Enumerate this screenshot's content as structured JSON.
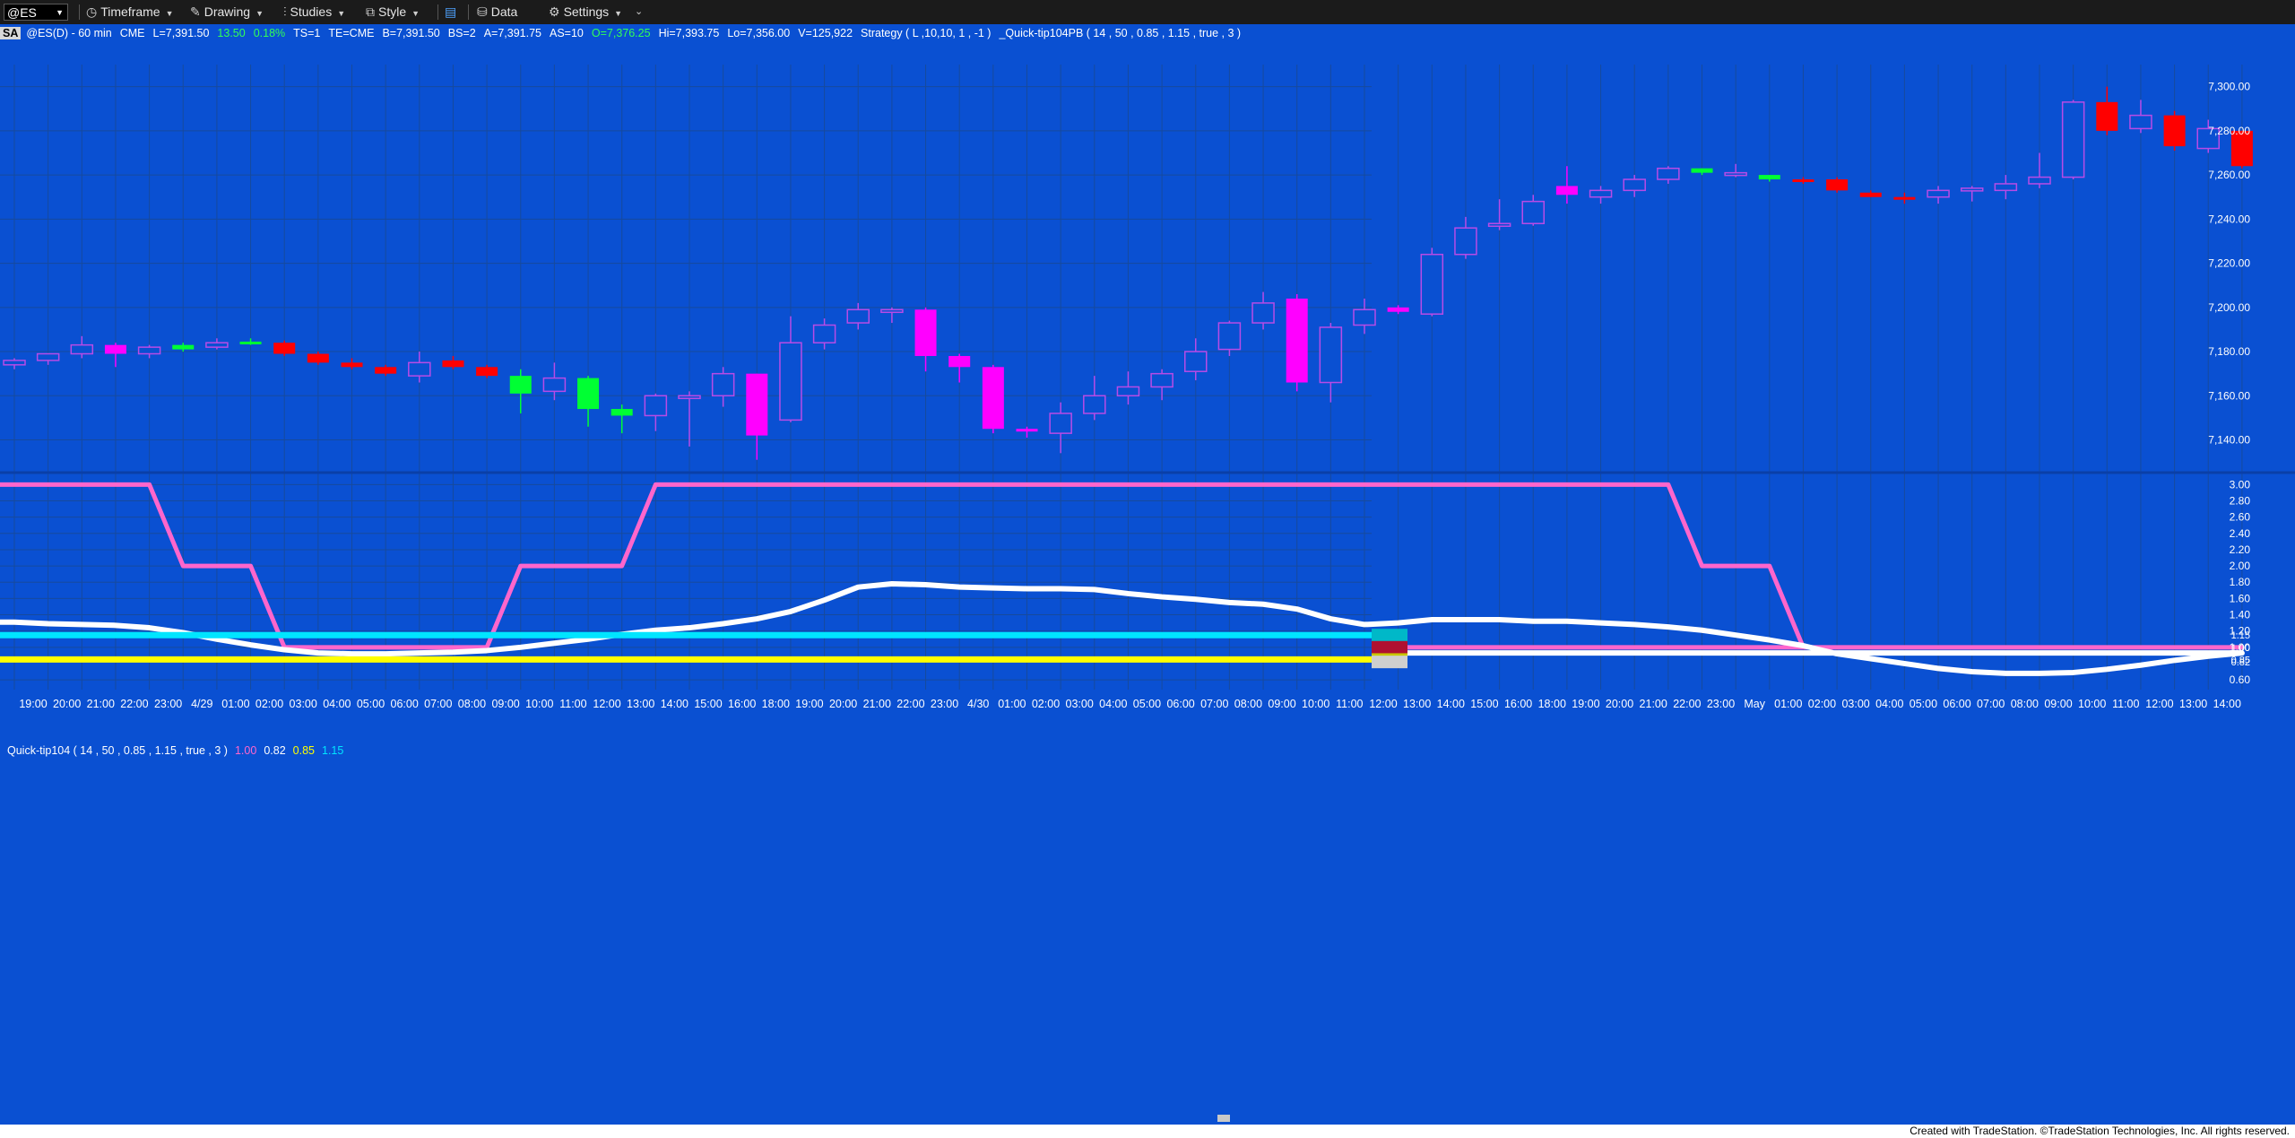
{
  "toolbar": {
    "symbol": "@ES",
    "timeframe_label": "Timeframe",
    "drawing_label": "Drawing",
    "studies_label": "Studies",
    "style_label": "Style",
    "data_label": "Data",
    "settings_label": "Settings"
  },
  "info_bar": {
    "badge": "SA",
    "symbol": "@ES(D) - 60 min",
    "exchange": "CME",
    "last": "L=7,391.50",
    "change": "13.50",
    "change_pct": "0.18%",
    "ts": "TS=1",
    "te": "TE=CME",
    "bid": "B=7,391.50",
    "bs": "BS=2",
    "ask": "A=7,391.75",
    "as": "AS=10",
    "open": "O=7,376.25",
    "high": "Hi=7,393.75",
    "low": "Lo=7,356.00",
    "volume": "V=125,922",
    "strategy": "Strategy ( L ,10,10, 1 , -1 )",
    "paintbar": "_Quick-tip104PB ( 14 , 50 , 0.85 , 1.15 , true , 3 )"
  },
  "indicator_bar": {
    "name": "Quick-tip104 ( 14 , 50 , 0.85 , 1.15 , true , 3 )",
    "v1": "1.00",
    "v2": "0.82",
    "v3": "0.85",
    "v4": "1.15"
  },
  "footer": {
    "text": "Created with TradeStation. ©TradeStation Technologies, Inc. All rights reserved."
  },
  "colors": {
    "background": "#0a50d2",
    "grid": "#174a9c",
    "up_hollow_magenta": "#b84be6",
    "down_magenta": "#ff00ff",
    "down_red": "#ff0000",
    "up_green": "#00ff33",
    "pink_line": "#ff66cc",
    "white_line": "#ffffff",
    "cyan_line": "#00e5ff",
    "yellow_line": "#ffff00",
    "dark_red": "#b01030"
  },
  "chart_data": [
    {
      "type": "candlestick",
      "title": "",
      "ylim": [
        7126,
        7310
      ],
      "y_ticks": [
        "7,140.00",
        "7,160.00",
        "7,180.00",
        "7,200.00",
        "7,220.00",
        "7,240.00",
        "7,260.00",
        "7,280.00",
        "7,300.00"
      ],
      "y_tick_values": [
        7140,
        7160,
        7180,
        7200,
        7220,
        7240,
        7260,
        7280,
        7300
      ],
      "x_tick_labels": [
        "19:00",
        "20:00",
        "21:00",
        "22:00",
        "23:00",
        "4/29",
        "01:00",
        "02:00",
        "03:00",
        "04:00",
        "05:00",
        "06:00",
        "07:00",
        "08:00",
        "09:00",
        "10:00",
        "11:00",
        "12:00",
        "13:00",
        "14:00",
        "15:00",
        "16:00",
        "18:00",
        "19:00",
        "20:00",
        "21:00",
        "22:00",
        "23:00",
        "4/30",
        "01:00",
        "02:00",
        "03:00",
        "04:00",
        "05:00",
        "06:00",
        "07:00",
        "08:00",
        "09:00",
        "10:00",
        "11:00",
        "12:00",
        "13:00",
        "14:00",
        "15:00",
        "16:00",
        "18:00",
        "19:00",
        "20:00",
        "21:00",
        "22:00",
        "23:00",
        "May",
        "01:00",
        "02:00",
        "03:00",
        "04:00",
        "05:00",
        "06:00",
        "07:00",
        "08:00",
        "09:00",
        "10:00",
        "11:00",
        "12:00",
        "13:00",
        "14:00"
      ],
      "candles": [
        {
          "o": 7174,
          "h": 7177,
          "l": 7172,
          "c": 7176,
          "style": "hollow"
        },
        {
          "o": 7176,
          "h": 7179,
          "l": 7174,
          "c": 7179,
          "style": "hollow"
        },
        {
          "o": 7179,
          "h": 7187,
          "l": 7177,
          "c": 7183,
          "style": "hollow"
        },
        {
          "o": 7183,
          "h": 7184,
          "l": 7173,
          "c": 7179,
          "style": "magenta"
        },
        {
          "o": 7179,
          "h": 7183,
          "l": 7177,
          "c": 7182,
          "style": "hollow"
        },
        {
          "o": 7181,
          "h": 7184,
          "l": 7180,
          "c": 7183,
          "style": "green"
        },
        {
          "o": 7182,
          "h": 7186,
          "l": 7181,
          "c": 7184,
          "style": "hollow"
        },
        {
          "o": 7184,
          "h": 7186,
          "l": 7183,
          "c": 7184.5,
          "style": "green"
        },
        {
          "o": 7184,
          "h": 7185,
          "l": 7178,
          "c": 7179,
          "style": "red"
        },
        {
          "o": 7179,
          "h": 7180,
          "l": 7174,
          "c": 7175,
          "style": "red"
        },
        {
          "o": 7175,
          "h": 7177,
          "l": 7172,
          "c": 7173,
          "style": "red"
        },
        {
          "o": 7173,
          "h": 7174,
          "l": 7169,
          "c": 7170,
          "style": "red"
        },
        {
          "o": 7169,
          "h": 7180,
          "l": 7166,
          "c": 7175,
          "style": "hollow"
        },
        {
          "o": 7176,
          "h": 7178,
          "l": 7172,
          "c": 7173,
          "style": "red"
        },
        {
          "o": 7173,
          "h": 7174,
          "l": 7168,
          "c": 7169,
          "style": "red"
        },
        {
          "o": 7169,
          "h": 7172,
          "l": 7152,
          "c": 7161,
          "style": "green"
        },
        {
          "o": 7162,
          "h": 7175,
          "l": 7158,
          "c": 7168,
          "style": "hollow"
        },
        {
          "o": 7168,
          "h": 7169,
          "l": 7146,
          "c": 7154,
          "style": "green"
        },
        {
          "o": 7154,
          "h": 7156,
          "l": 7143,
          "c": 7151,
          "style": "green"
        },
        {
          "o": 7151,
          "h": 7161,
          "l": 7144,
          "c": 7160,
          "style": "hollow"
        },
        {
          "o": 7160,
          "h": 7162,
          "l": 7137,
          "c": 7159,
          "style": "hollow"
        },
        {
          "o": 7160,
          "h": 7173,
          "l": 7155,
          "c": 7170,
          "style": "hollow"
        },
        {
          "o": 7170,
          "h": 7170,
          "l": 7131,
          "c": 7142,
          "style": "magenta"
        },
        {
          "o": 7149,
          "h": 7196,
          "l": 7148,
          "c": 7184,
          "style": "hollow"
        },
        {
          "o": 7184,
          "h": 7195,
          "l": 7181,
          "c": 7192,
          "style": "hollow"
        },
        {
          "o": 7193,
          "h": 7202,
          "l": 7190,
          "c": 7199,
          "style": "hollow"
        },
        {
          "o": 7199,
          "h": 7200,
          "l": 7193,
          "c": 7199,
          "style": "hollow"
        },
        {
          "o": 7199,
          "h": 7200,
          "l": 7171,
          "c": 7178,
          "style": "magenta"
        },
        {
          "o": 7178,
          "h": 7179,
          "l": 7166,
          "c": 7173,
          "style": "magenta"
        },
        {
          "o": 7173,
          "h": 7174,
          "l": 7143,
          "c": 7145,
          "style": "magenta"
        },
        {
          "o": 7145,
          "h": 7146,
          "l": 7141,
          "c": 7144,
          "style": "magenta"
        },
        {
          "o": 7143,
          "h": 7157,
          "l": 7134,
          "c": 7152,
          "style": "hollow"
        },
        {
          "o": 7152,
          "h": 7169,
          "l": 7149,
          "c": 7160,
          "style": "hollow"
        },
        {
          "o": 7160,
          "h": 7171,
          "l": 7156,
          "c": 7164,
          "style": "hollow"
        },
        {
          "o": 7164,
          "h": 7172,
          "l": 7158,
          "c": 7170,
          "style": "hollow"
        },
        {
          "o": 7171,
          "h": 7186,
          "l": 7167,
          "c": 7180,
          "style": "hollow"
        },
        {
          "o": 7181,
          "h": 7194,
          "l": 7178,
          "c": 7193,
          "style": "hollow"
        },
        {
          "o": 7193,
          "h": 7207,
          "l": 7190,
          "c": 7202,
          "style": "hollow"
        },
        {
          "o": 7204,
          "h": 7206,
          "l": 7162,
          "c": 7166,
          "style": "magenta"
        },
        {
          "o": 7166,
          "h": 7193,
          "l": 7157,
          "c": 7191,
          "style": "hollow"
        },
        {
          "o": 7192,
          "h": 7204,
          "l": 7188,
          "c": 7199,
          "style": "hollow"
        },
        {
          "o": 7200,
          "h": 7201,
          "l": 7197,
          "c": 7198,
          "style": "magenta"
        },
        {
          "o": 7197,
          "h": 7227,
          "l": 7196,
          "c": 7224,
          "style": "hollow"
        },
        {
          "o": 7224,
          "h": 7241,
          "l": 7222,
          "c": 7236,
          "style": "hollow"
        },
        {
          "o": 7237,
          "h": 7249,
          "l": 7235,
          "c": 7238,
          "style": "hollow"
        },
        {
          "o": 7238,
          "h": 7251,
          "l": 7237,
          "c": 7248,
          "style": "hollow"
        },
        {
          "o": 7251,
          "h": 7264,
          "l": 7247,
          "c": 7255,
          "style": "magenta"
        },
        {
          "o": 7250,
          "h": 7255,
          "l": 7247,
          "c": 7253,
          "style": "hollow"
        },
        {
          "o": 7253,
          "h": 7260,
          "l": 7250,
          "c": 7258,
          "style": "hollow"
        },
        {
          "o": 7258,
          "h": 7264,
          "l": 7256,
          "c": 7263,
          "style": "hollow"
        },
        {
          "o": 7263,
          "h": 7263,
          "l": 7260,
          "c": 7261,
          "style": "green"
        },
        {
          "o": 7261,
          "h": 7265,
          "l": 7259,
          "c": 7260,
          "style": "hollow"
        },
        {
          "o": 7260,
          "h": 7260,
          "l": 7257,
          "c": 7258,
          "style": "green"
        },
        {
          "o": 7258,
          "h": 7259,
          "l": 7256,
          "c": 7257,
          "style": "red"
        },
        {
          "o": 7258,
          "h": 7259,
          "l": 7252,
          "c": 7253,
          "style": "red"
        },
        {
          "o": 7252,
          "h": 7253,
          "l": 7250,
          "c": 7250,
          "style": "red"
        },
        {
          "o": 7250,
          "h": 7252,
          "l": 7247,
          "c": 7249,
          "style": "red"
        },
        {
          "o": 7250,
          "h": 7255,
          "l": 7247,
          "c": 7253,
          "style": "hollow"
        },
        {
          "o": 7253,
          "h": 7255,
          "l": 7248,
          "c": 7254,
          "style": "hollow"
        },
        {
          "o": 7253,
          "h": 7260,
          "l": 7249,
          "c": 7256,
          "style": "hollow"
        },
        {
          "o": 7256,
          "h": 7270,
          "l": 7254,
          "c": 7259,
          "style": "hollow"
        },
        {
          "o": 7259,
          "h": 7294,
          "l": 7258,
          "c": 7293,
          "style": "hollow"
        },
        {
          "o": 7293,
          "h": 7300,
          "l": 7278,
          "c": 7280,
          "style": "red"
        },
        {
          "o": 7281,
          "h": 7294,
          "l": 7279,
          "c": 7287,
          "style": "hollow"
        },
        {
          "o": 7287,
          "h": 7289,
          "l": 7271,
          "c": 7273,
          "style": "red"
        },
        {
          "o": 7272,
          "h": 7285,
          "l": 7270,
          "c": 7281,
          "style": "hollow"
        },
        {
          "o": 7280,
          "h": 7280,
          "l": 7263,
          "c": 7264,
          "style": "red"
        }
      ]
    },
    {
      "type": "line",
      "title": "",
      "ylim": [
        0.48,
        3.07
      ],
      "y_ticks": [
        "0.60",
        "1.00",
        "1.20",
        "1.40",
        "1.60",
        "1.80",
        "2.00",
        "2.20",
        "2.40",
        "2.60",
        "2.80",
        "3.00"
      ],
      "y_tick_values": [
        0.6,
        1.0,
        1.2,
        1.4,
        1.6,
        1.8,
        2.0,
        2.2,
        2.4,
        2.6,
        2.8,
        3.0
      ],
      "series": [
        {
          "color": "#ff66cc",
          "values": [
            3,
            3,
            3,
            3,
            3,
            2,
            2,
            2,
            1,
            1,
            1,
            1,
            1,
            1,
            1,
            2,
            2,
            2,
            2,
            3,
            3,
            3,
            3,
            3,
            3,
            3,
            3,
            3,
            3,
            3,
            3,
            3,
            3,
            3,
            3,
            3,
            3,
            3,
            3,
            3,
            3,
            3,
            3,
            3,
            3,
            3,
            3,
            3,
            3,
            3,
            2,
            2,
            2,
            1,
            1,
            1,
            1,
            1,
            1,
            1,
            1,
            1,
            1,
            1,
            1,
            1,
            1
          ]
        },
        {
          "color": "#ffffff",
          "values": [
            1.31,
            1.29,
            1.28,
            1.27,
            1.24,
            1.18,
            1.1,
            1.03,
            0.97,
            0.93,
            0.92,
            0.92,
            0.93,
            0.94,
            0.96,
            1.0,
            1.05,
            1.1,
            1.16,
            1.21,
            1.24,
            1.29,
            1.35,
            1.44,
            1.58,
            1.74,
            1.78,
            1.77,
            1.74,
            1.73,
            1.72,
            1.72,
            1.71,
            1.66,
            1.62,
            1.59,
            1.55,
            1.53,
            1.47,
            1.35,
            1.28,
            1.3,
            1.34,
            1.34,
            1.34,
            1.32,
            1.32,
            1.3,
            1.28,
            1.25,
            1.21,
            1.15,
            1.09,
            1.02,
            0.92,
            0.86,
            0.8,
            0.74,
            0.7,
            0.68,
            0.68,
            0.69,
            0.73,
            0.78,
            0.84,
            0.89,
            0.93
          ]
        },
        {
          "color": "#00e5ff",
          "values": [
            1.15
          ]
        },
        {
          "color": "#ffff00",
          "values": [
            0.85
          ]
        }
      ],
      "axis_markers": [
        {
          "value": 1.15,
          "text": "1.15",
          "color": "#00b8c8"
        },
        {
          "value": 1.0,
          "text": "1.00",
          "color": "#b01030"
        },
        {
          "value": 0.85,
          "text": "0.85",
          "color": "#c8c800"
        },
        {
          "value": 0.82,
          "text": "0.82",
          "color": "#cfcfcf"
        }
      ]
    }
  ]
}
